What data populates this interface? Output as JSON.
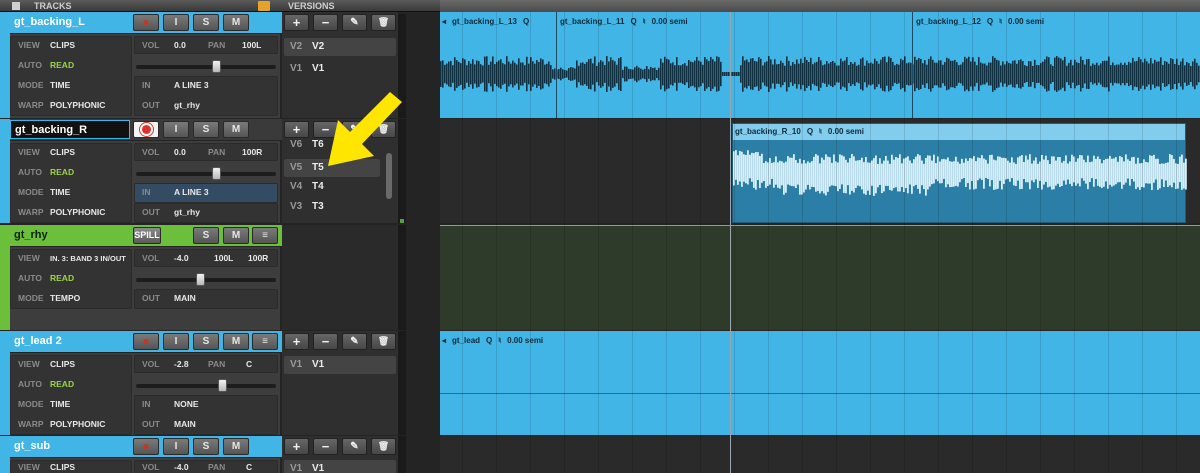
{
  "header": {
    "tracks_label": "TRACKS",
    "versions_label": "VERSIONS"
  },
  "colors": {
    "accent_blue": "#41b6e6",
    "rhythm_green": "#6bbf3a",
    "clip_dark": "#1e6a8c",
    "record_red": "#e0302b"
  },
  "version_buttons": {
    "add": "+",
    "remove": "−",
    "edit": "✎",
    "delete": "🗑"
  },
  "tracks": [
    {
      "name": "gt_backing_L",
      "record": "●",
      "input_mon": "I",
      "solo": "S",
      "mute": "M",
      "view_label": "VIEW",
      "view": "CLIPS",
      "auto_label": "AUTO",
      "auto": "READ",
      "mode_label": "MODE",
      "mode": "TIME",
      "warp_label": "WARP",
      "warp": "POLYPHONIC",
      "vol_label": "VOL",
      "vol": "0.0",
      "pan_label": "PAN",
      "pan": "100L",
      "in_label": "IN",
      "in": "A LINE 3",
      "out_label": "OUT",
      "out": "gt_rhy",
      "versions": [
        {
          "label": "V2",
          "value": "V2"
        },
        {
          "label": "V1",
          "value": "V1"
        }
      ]
    },
    {
      "name": "gt_backing_R",
      "record": "●",
      "input_mon": "I",
      "solo": "S",
      "mute": "M",
      "view_label": "VIEW",
      "view": "CLIPS",
      "auto_label": "AUTO",
      "auto": "READ",
      "mode_label": "MODE",
      "mode": "TIME",
      "warp_label": "WARP",
      "warp": "POLYPHONIC",
      "vol_label": "VOL",
      "vol": "0.0",
      "pan_label": "PAN",
      "pan": "100R",
      "in_label": "IN",
      "in": "A LINE 3",
      "out_label": "OUT",
      "out": "gt_rhy",
      "versions": [
        {
          "label": "V6",
          "value": "T6"
        },
        {
          "label": "V5",
          "value": "T5"
        },
        {
          "label": "V4",
          "value": "T4"
        },
        {
          "label": "V3",
          "value": "T3"
        }
      ]
    },
    {
      "name": "gt_rhy",
      "spill": "SPILL",
      "solo": "S",
      "mute": "M",
      "view_label": "VIEW",
      "view": "IN. 3: BAND 3 IN/OUT",
      "auto_label": "AUTO",
      "auto": "READ",
      "mode_label": "MODE",
      "mode": "TEMPO",
      "vol_label": "VOL",
      "vol": "-4.0",
      "pan_l": "100L",
      "pan_r": "100R",
      "out_label": "OUT",
      "out": "MAIN"
    },
    {
      "name": "gt_lead 2",
      "record": "●",
      "input_mon": "I",
      "solo": "S",
      "mute": "M",
      "view_label": "VIEW",
      "view": "CLIPS",
      "auto_label": "AUTO",
      "auto": "READ",
      "mode_label": "MODE",
      "mode": "TIME",
      "warp_label": "WARP",
      "warp": "POLYPHONIC",
      "vol_label": "VOL",
      "vol": "-2.8",
      "pan_label": "PAN",
      "pan": "C",
      "in_label": "IN",
      "in": "NONE",
      "out_label": "OUT",
      "out": "MAIN",
      "versions": [
        {
          "label": "V1",
          "value": "V1"
        }
      ]
    },
    {
      "name": "gt_sub",
      "record": "●",
      "input_mon": "I",
      "solo": "S",
      "mute": "M",
      "view_label": "VIEW",
      "view": "CLIPS",
      "vol_label": "VOL",
      "vol": "-4.0",
      "pan_label": "PAN",
      "pan": "C",
      "versions": [
        {
          "label": "V1",
          "value": "V1"
        }
      ]
    }
  ],
  "clips": {
    "t1": [
      {
        "name": "gt_backing_L_13",
        "q": "Q"
      },
      {
        "name": "gt_backing_L_11",
        "q": "Q",
        "warp": "0.00 semi"
      },
      {
        "name": "gt_backing_L_12",
        "q": "Q",
        "warp": "0.00 semi"
      }
    ],
    "t2": [
      {
        "name": "gt_backing_R_10",
        "q": "Q",
        "warp": "0.00 semi"
      }
    ],
    "t4": [
      {
        "name": "gt_lead",
        "q": "Q",
        "warp": "0.00 semi"
      }
    ]
  },
  "pitch_icon": "♮",
  "left_arrow_icon": "◂"
}
